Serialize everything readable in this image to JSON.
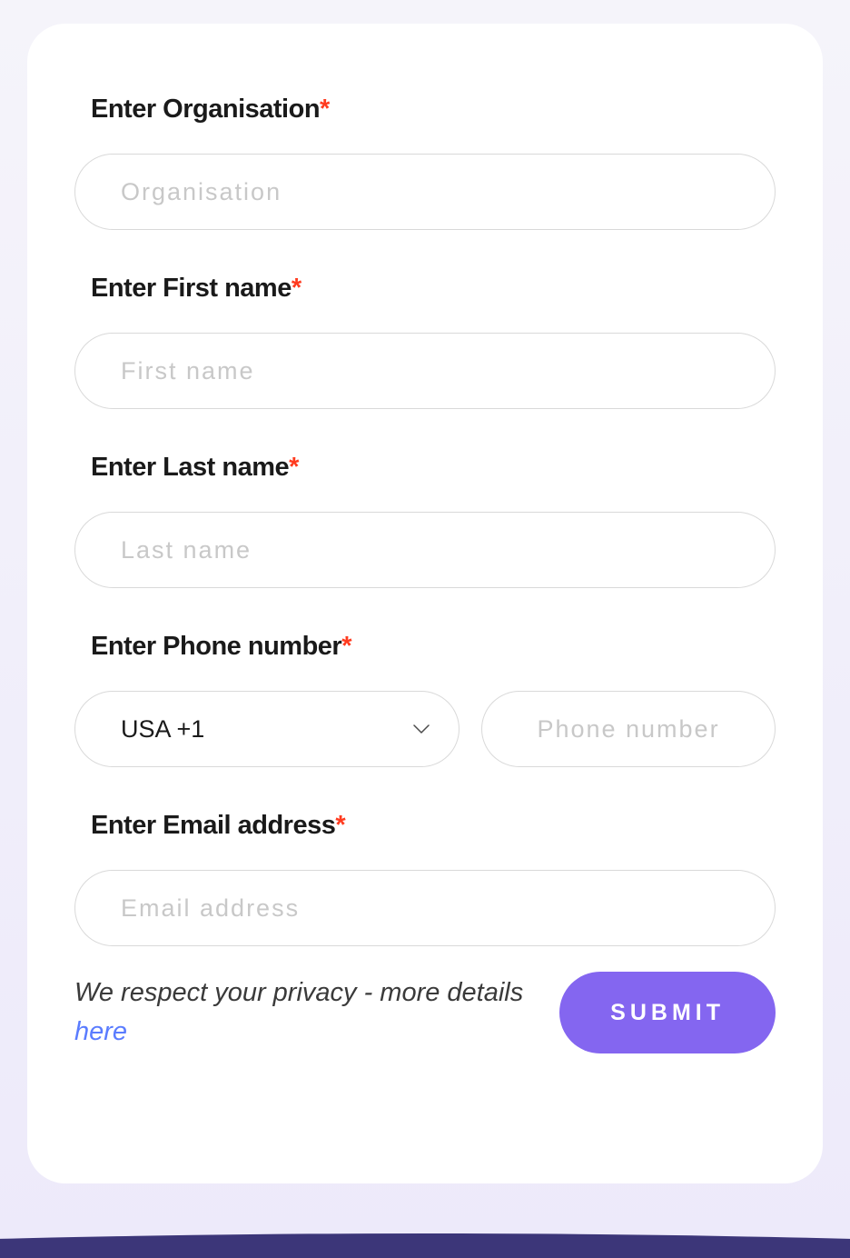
{
  "form": {
    "organisation": {
      "label": "Enter Organisation",
      "required_mark": "*",
      "placeholder": "Organisation",
      "value": ""
    },
    "first_name": {
      "label": "Enter First name",
      "required_mark": "*",
      "placeholder": "First name",
      "value": ""
    },
    "last_name": {
      "label": "Enter Last name",
      "required_mark": "*",
      "placeholder": "Last name",
      "value": ""
    },
    "phone": {
      "label": "Enter Phone number",
      "required_mark": "*",
      "country_selected": "USA +1",
      "placeholder": "Phone number",
      "value": ""
    },
    "email": {
      "label": "Enter Email address",
      "required_mark": "*",
      "placeholder": "Email address",
      "value": ""
    }
  },
  "footer": {
    "privacy_text": "We respect your privacy - more details ",
    "privacy_link_text": "here",
    "submit_label": "SUBMIT"
  },
  "colors": {
    "accent": "#8466f0",
    "required": "#ff3b1f",
    "link": "#5a7cff"
  }
}
